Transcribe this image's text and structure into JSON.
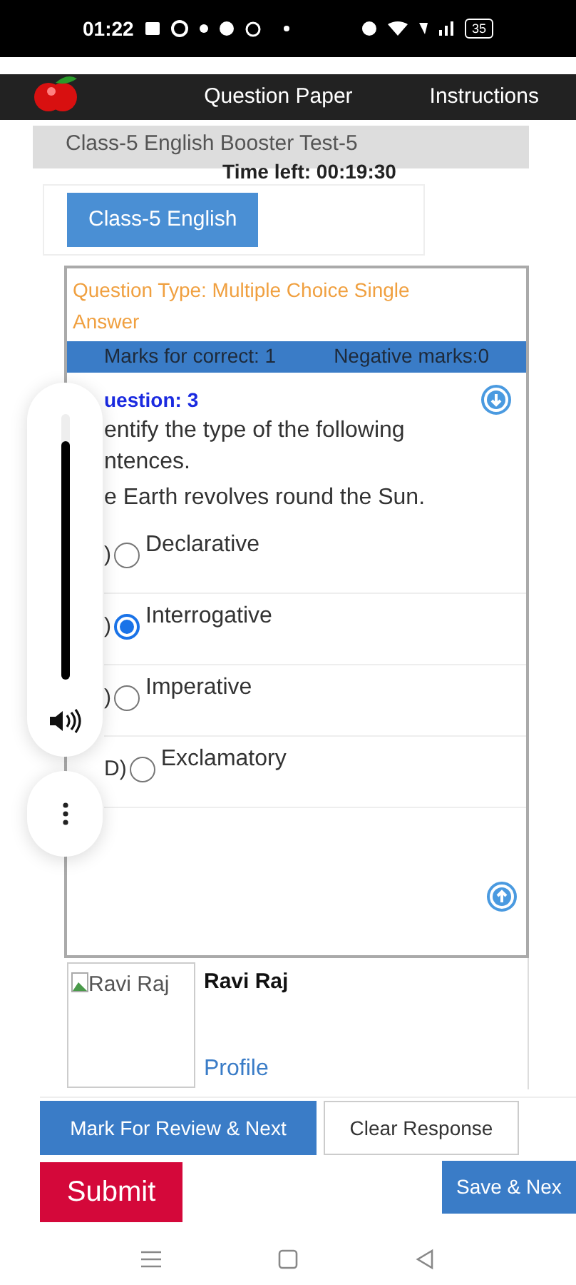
{
  "status_bar": {
    "time": "01:22",
    "battery": "35"
  },
  "nav": {
    "items": [
      "Question Paper",
      "Instructions"
    ]
  },
  "test_title": "Class-5 English Booster Test-5",
  "timer": "Time left: 00:19:30",
  "sections": [
    {
      "label": "Class-5 English",
      "selected": true
    }
  ],
  "question": {
    "type": "Question Type: Multiple Choice Single Answer",
    "marks_correct": "Marks for correct: 1",
    "negative_marks": "Negative marks:0",
    "number": "uestion: 3",
    "text": [
      "entify the type of the following",
      "ntences.",
      "e Earth revolves round the Sun."
    ],
    "options": [
      {
        "letter": ")",
        "label": "Declarative",
        "selected": false
      },
      {
        "letter": ")",
        "label": "Interrogative",
        "selected": true
      },
      {
        "letter": ")",
        "label": "Imperative",
        "selected": false
      },
      {
        "letter": "D)",
        "label": "Exclamatory",
        "selected": false
      }
    ]
  },
  "volume_overlay": {
    "level": 0.9
  },
  "profile": {
    "image_alt": "Ravi Raj",
    "name": "Ravi Raj",
    "link": "Profile"
  },
  "buttons": [
    {
      "kind": "primary",
      "label": "Mark For Review & Next"
    },
    {
      "kind": "outline",
      "label": "Clear Response"
    },
    {
      "kind": "danger",
      "label": "Submit"
    },
    {
      "kind": "primary",
      "label": "Save & Nex"
    }
  ]
}
